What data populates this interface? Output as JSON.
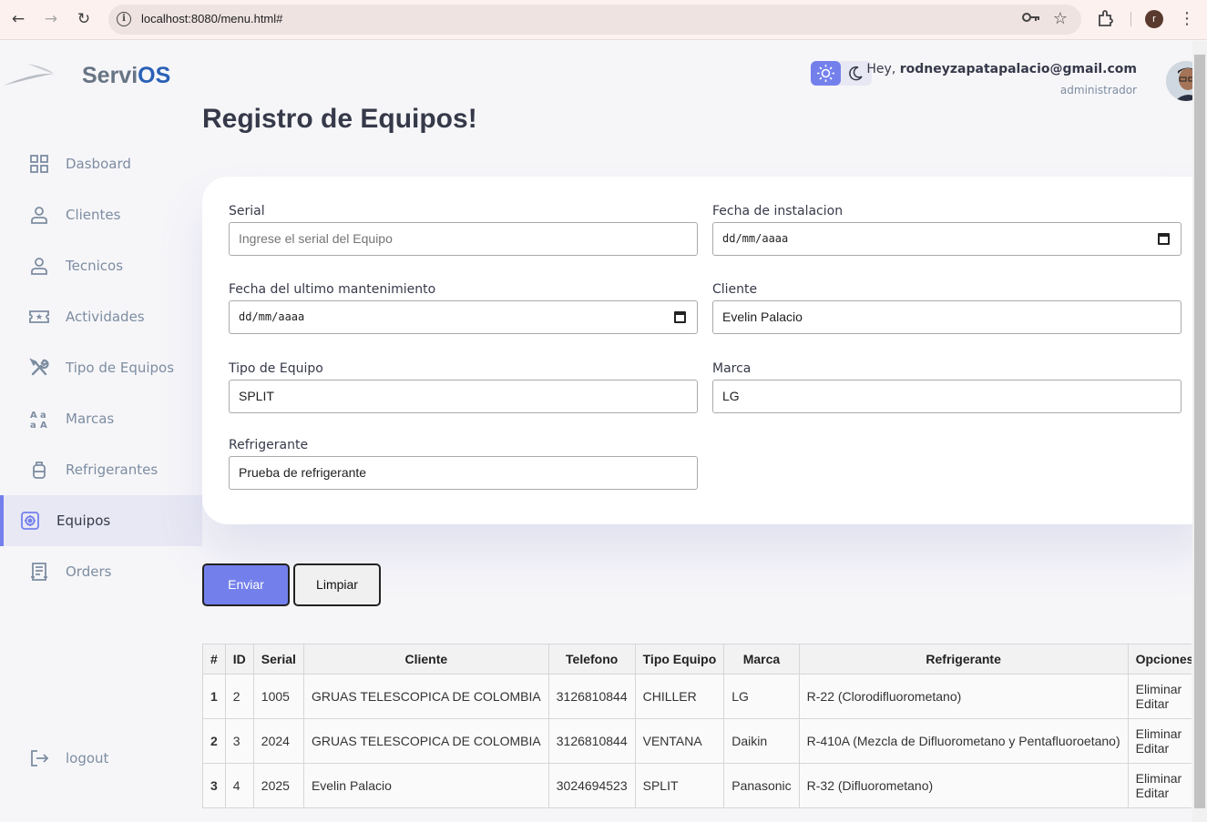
{
  "browser": {
    "url": "localhost:8080/menu.html#",
    "profile_initial": "r",
    "back_glyph": "←",
    "forward_glyph": "→",
    "reload_glyph": "↻",
    "star_glyph": "☆",
    "dots_glyph": "⋮"
  },
  "brand": {
    "name_part1": "Servi",
    "name_part2": "OS"
  },
  "sidebar": {
    "items": [
      {
        "label": "Dasboard",
        "icon": "grid-icon"
      },
      {
        "label": "Clientes",
        "icon": "person-icon"
      },
      {
        "label": "Tecnicos",
        "icon": "person-icon"
      },
      {
        "label": "Actividades",
        "icon": "ticket-icon"
      },
      {
        "label": "Tipo de Equipos",
        "icon": "tools-icon"
      },
      {
        "label": "Marcas",
        "icon": "translate-icon"
      },
      {
        "label": "Refrigerantes",
        "icon": "tank-icon"
      },
      {
        "label": "Equipos",
        "icon": "gear-icon",
        "active": true
      },
      {
        "label": "Orders",
        "icon": "receipt-icon"
      }
    ],
    "logout_label": "logout"
  },
  "header": {
    "greeting": "Hey,",
    "email": "rodneyzapatapalacio@gmail.com",
    "role": "administrador",
    "accent_color": "#7380ec"
  },
  "page": {
    "title": "Registro de Equipos!"
  },
  "form": {
    "serial": {
      "label": "Serial",
      "placeholder": "Ingrese el serial del Equipo",
      "value": ""
    },
    "fecha_instalacion": {
      "label": "Fecha de instalacion",
      "value": "dd/mm/aaaa"
    },
    "fecha_mantenimiento": {
      "label": "Fecha del ultimo mantenimiento",
      "value": "dd/mm/aaaa"
    },
    "cliente": {
      "label": "Cliente",
      "value": "Evelin Palacio"
    },
    "tipo_equipo": {
      "label": "Tipo de Equipo",
      "value": "SPLIT"
    },
    "marca": {
      "label": "Marca",
      "value": "LG"
    },
    "refrigerante": {
      "label": "Refrigerante",
      "value": "Prueba de refrigerante"
    },
    "submit_label": "Enviar",
    "clear_label": "Limpiar"
  },
  "table": {
    "headers": [
      "#",
      "ID",
      "Serial",
      "Cliente",
      "Telefono",
      "Tipo Equipo",
      "Marca",
      "Refrigerante",
      "Opciones"
    ],
    "rows": [
      {
        "n": "1",
        "id": "2",
        "serial": "1005",
        "cliente": "GRUAS TELESCOPICA DE COLOMBIA",
        "telefono": "3126810844",
        "tipo": "CHILLER",
        "marca": "LG",
        "refrigerante": "R-22 (Clorodifluorometano)",
        "eliminar": "Eliminar",
        "editar": "Editar"
      },
      {
        "n": "2",
        "id": "3",
        "serial": "2024",
        "cliente": "GRUAS TELESCOPICA DE COLOMBIA",
        "telefono": "3126810844",
        "tipo": "VENTANA",
        "marca": "Daikin",
        "refrigerante": "R-410A (Mezcla de Difluorometano y Pentafluoroetano)",
        "eliminar": "Eliminar",
        "editar": "Editar"
      },
      {
        "n": "3",
        "id": "4",
        "serial": "2025",
        "cliente": "Evelin Palacio",
        "telefono": "3024694523",
        "tipo": "SPLIT",
        "marca": "Panasonic",
        "refrigerante": "R-32 (Difluorometano)",
        "eliminar": "Eliminar",
        "editar": "Editar"
      }
    ]
  }
}
